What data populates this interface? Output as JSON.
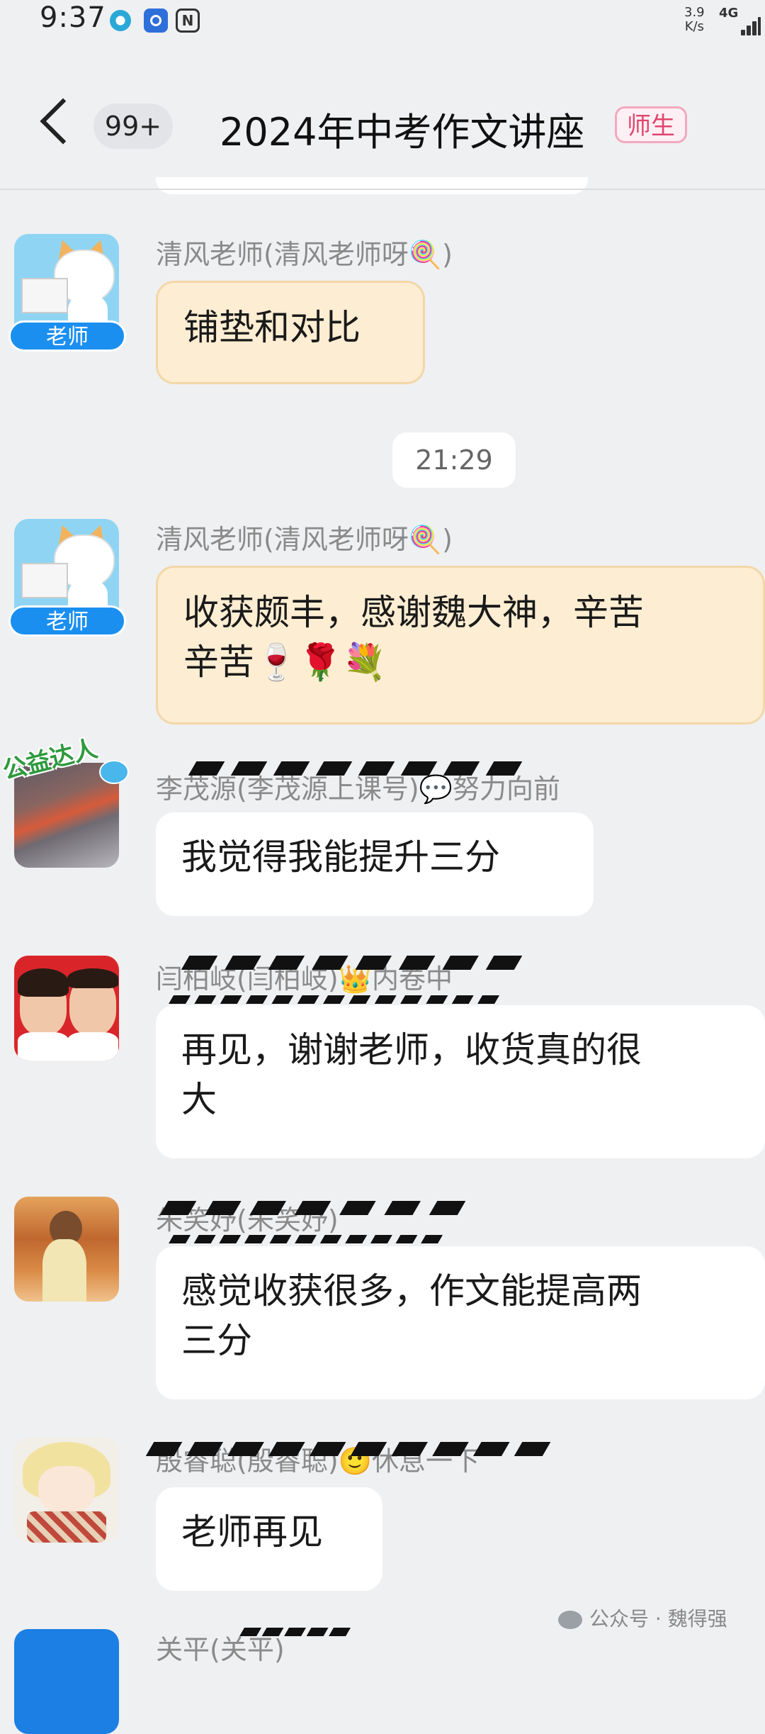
{
  "status_bar": {
    "time": "9:37",
    "speed_value": "3.9",
    "speed_unit": "K/s",
    "network": "4G",
    "nfc_letter": "N"
  },
  "header": {
    "unread_count": "99+",
    "title": "2024年中考作文讲座",
    "role_tag": "师生"
  },
  "time_separator": "21:29",
  "teacher_tag": "老师",
  "messages": [
    {
      "sender": "清风老师(清风老师呀🍭)",
      "text": "铺垫和对比"
    },
    {
      "sender": "清风老师(清风老师呀🍭)",
      "text_line1": "收获颇丰，感谢魏大神，辛苦",
      "text_line2": "辛苦🍷🌹💐"
    },
    {
      "sender": "李茂源(李茂源上课号)💬努力向前",
      "badge": "公益达人",
      "text": "我觉得我能提升三分"
    },
    {
      "sender": "闫柏岐(闫柏岐)👑内卷中",
      "text_line1": "再见，谢谢老师，收货真的很",
      "text_line2": "大"
    },
    {
      "sender": "朱笑妤(朱笑妤)",
      "text_line1": "感觉收获很多，作文能提高两",
      "text_line2": "三分"
    },
    {
      "sender": "殷睿聪(殷睿聪)🙂休息一下",
      "text": "老师再见"
    },
    {
      "sender": "关平(关平)"
    }
  ],
  "watermark": "公众号 · 魏得强",
  "colors": {
    "background": "#eff0f2",
    "teacher_bubble": "#fdedd2",
    "student_bubble": "#ffffff",
    "teacher_tag": "#1b8ff0",
    "role_tag_text": "#e0456f"
  }
}
